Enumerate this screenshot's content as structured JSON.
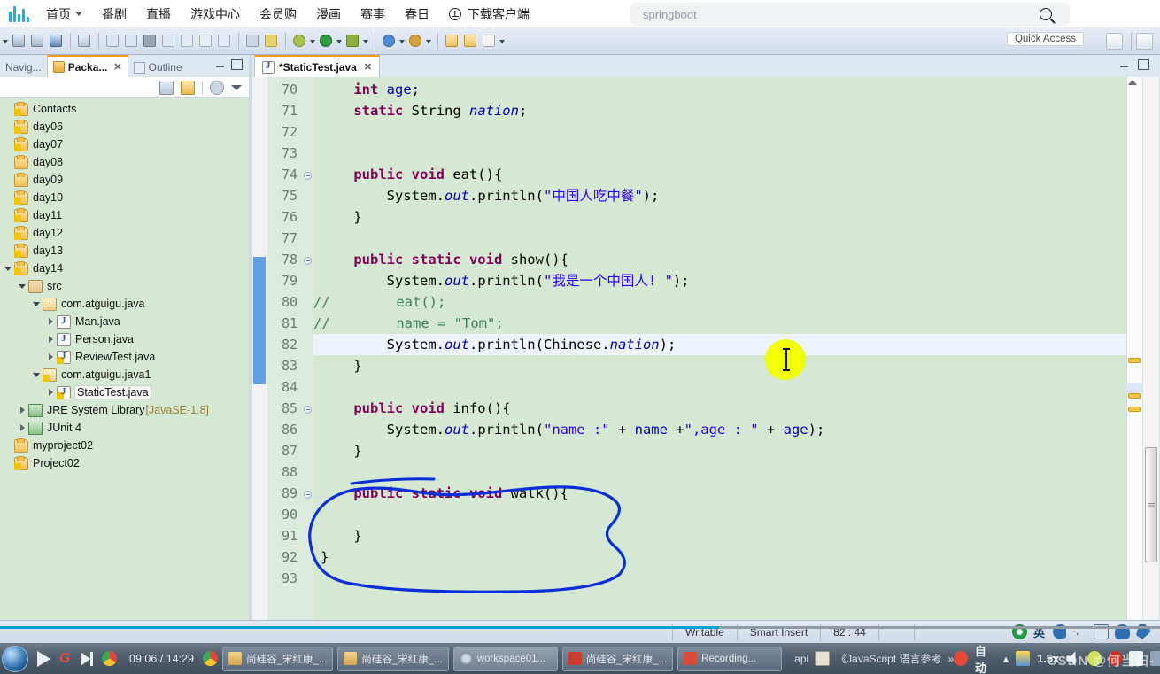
{
  "bilibili": {
    "logo_name": "bilibili-logo",
    "nav": [
      {
        "label": "首页",
        "has_caret": true
      },
      {
        "label": "番剧",
        "has_caret": false
      },
      {
        "label": "直播",
        "has_caret": false
      },
      {
        "label": "游戏中心",
        "has_caret": false
      },
      {
        "label": "会员购",
        "has_caret": false
      },
      {
        "label": "漫画",
        "has_caret": false
      },
      {
        "label": "赛事",
        "has_caret": false
      },
      {
        "label": "春日",
        "has_caret": false
      }
    ],
    "download_label": "下载客户端",
    "search": {
      "value": "springboot",
      "placeholder": "搜索"
    }
  },
  "eclipse": {
    "quick_access": "Quick Access",
    "explorer": {
      "tabs": [
        {
          "label": "Navig...",
          "active": false
        },
        {
          "label": "Packa...",
          "active": true
        },
        {
          "label": "Outline",
          "active": false
        }
      ],
      "tree": [
        {
          "label": "Contacts",
          "depth": 0,
          "icon": "project-warn",
          "twist": "none"
        },
        {
          "label": "day06",
          "depth": 0,
          "icon": "project-warn",
          "twist": "none"
        },
        {
          "label": "day07",
          "depth": 0,
          "icon": "project-warn",
          "twist": "none"
        },
        {
          "label": "day08",
          "depth": 0,
          "icon": "project",
          "twist": "none"
        },
        {
          "label": "day09",
          "depth": 0,
          "icon": "project",
          "twist": "none"
        },
        {
          "label": "day10",
          "depth": 0,
          "icon": "project-warn",
          "twist": "none"
        },
        {
          "label": "day11",
          "depth": 0,
          "icon": "project-warn",
          "twist": "none"
        },
        {
          "label": "day12",
          "depth": 0,
          "icon": "project-warn",
          "twist": "none"
        },
        {
          "label": "day13",
          "depth": 0,
          "icon": "project-warn",
          "twist": "none"
        },
        {
          "label": "day14",
          "depth": 0,
          "icon": "project-warn",
          "twist": "open"
        },
        {
          "label": "src",
          "depth": 1,
          "icon": "src",
          "twist": "open"
        },
        {
          "label": "com.atguigu.java",
          "depth": 2,
          "icon": "package",
          "twist": "open"
        },
        {
          "label": "Man.java",
          "depth": 3,
          "icon": "java",
          "twist": "closed"
        },
        {
          "label": "Person.java",
          "depth": 3,
          "icon": "java",
          "twist": "closed"
        },
        {
          "label": "ReviewTest.java",
          "depth": 3,
          "icon": "java-warn",
          "twist": "closed"
        },
        {
          "label": "com.atguigu.java1",
          "depth": 2,
          "icon": "package-warn",
          "twist": "open"
        },
        {
          "label": "StaticTest.java",
          "depth": 3,
          "icon": "java-warn",
          "twist": "closed",
          "selected": true
        },
        {
          "label": "JRE System Library",
          "suffix": "[JavaSE-1.8]",
          "depth": 1,
          "icon": "library",
          "twist": "closed"
        },
        {
          "label": "JUnit 4",
          "depth": 1,
          "icon": "library",
          "twist": "closed"
        },
        {
          "label": "myproject02",
          "depth": 0,
          "icon": "project",
          "twist": "none"
        },
        {
          "label": "Project02",
          "depth": 0,
          "icon": "project-warn",
          "twist": "none"
        }
      ]
    },
    "editor": {
      "tab_label": "*StaticTest.java",
      "first_line": 70,
      "lines": [
        {
          "n": 70,
          "fold": false,
          "tokens": [
            {
              "t": "    ",
              "c": ""
            },
            {
              "t": "int",
              "c": "kw"
            },
            {
              "t": " ",
              "c": ""
            },
            {
              "t": "age",
              "c": "fld"
            },
            {
              "t": ";",
              "c": ""
            }
          ]
        },
        {
          "n": 71,
          "fold": false,
          "tokens": [
            {
              "t": "    ",
              "c": ""
            },
            {
              "t": "static",
              "c": "kw"
            },
            {
              "t": " String ",
              "c": ""
            },
            {
              "t": "nation",
              "c": "stat"
            },
            {
              "t": ";",
              "c": ""
            }
          ]
        },
        {
          "n": 72,
          "fold": false,
          "tokens": []
        },
        {
          "n": 73,
          "fold": false,
          "tokens": []
        },
        {
          "n": 74,
          "fold": true,
          "tokens": [
            {
              "t": "    ",
              "c": ""
            },
            {
              "t": "public void",
              "c": "kw"
            },
            {
              "t": " eat(){",
              "c": ""
            }
          ]
        },
        {
          "n": 75,
          "fold": false,
          "tokens": [
            {
              "t": "        System.",
              "c": ""
            },
            {
              "t": "out",
              "c": "stat"
            },
            {
              "t": ".println(",
              "c": ""
            },
            {
              "t": "\"中国人吃中餐\"",
              "c": "str"
            },
            {
              "t": ");",
              "c": ""
            }
          ]
        },
        {
          "n": 76,
          "fold": false,
          "tokens": [
            {
              "t": "    }",
              "c": ""
            }
          ]
        },
        {
          "n": 77,
          "fold": false,
          "tokens": []
        },
        {
          "n": 78,
          "fold": true,
          "tokens": [
            {
              "t": "    ",
              "c": ""
            },
            {
              "t": "public static void",
              "c": "kw"
            },
            {
              "t": " show(){",
              "c": ""
            }
          ]
        },
        {
          "n": 79,
          "fold": false,
          "tokens": [
            {
              "t": "        System.",
              "c": ""
            },
            {
              "t": "out",
              "c": "stat"
            },
            {
              "t": ".println(",
              "c": ""
            },
            {
              "t": "\"我是一个中国人! \"",
              "c": "str"
            },
            {
              "t": ");",
              "c": ""
            }
          ]
        },
        {
          "n": 80,
          "fold": false,
          "comment_prefix": "//",
          "tokens": [
            {
              "t": "        eat();",
              "c": "cmt"
            }
          ]
        },
        {
          "n": 81,
          "fold": false,
          "comment_prefix": "//",
          "tokens": [
            {
              "t": "        name = ",
              "c": "cmt"
            },
            {
              "t": "\"Tom\"",
              "c": "cmt"
            },
            {
              "t": ";",
              "c": "cmt"
            }
          ]
        },
        {
          "n": 82,
          "fold": false,
          "highlight": true,
          "tokens": [
            {
              "t": "        System.",
              "c": ""
            },
            {
              "t": "out",
              "c": "stat"
            },
            {
              "t": ".println(Chinese.",
              "c": ""
            },
            {
              "t": "nation",
              "c": "stat"
            },
            {
              "t": ");",
              "c": ""
            }
          ]
        },
        {
          "n": 83,
          "fold": false,
          "tokens": [
            {
              "t": "    }",
              "c": ""
            }
          ]
        },
        {
          "n": 84,
          "fold": false,
          "tokens": []
        },
        {
          "n": 85,
          "fold": true,
          "tokens": [
            {
              "t": "    ",
              "c": ""
            },
            {
              "t": "public void",
              "c": "kw"
            },
            {
              "t": " info(){",
              "c": ""
            }
          ]
        },
        {
          "n": 86,
          "fold": false,
          "tokens": [
            {
              "t": "        System.",
              "c": ""
            },
            {
              "t": "out",
              "c": "stat"
            },
            {
              "t": ".println(",
              "c": ""
            },
            {
              "t": "\"name :\"",
              "c": "str"
            },
            {
              "t": " + ",
              "c": ""
            },
            {
              "t": "name",
              "c": "fld"
            },
            {
              "t": " +",
              "c": ""
            },
            {
              "t": "\",age : \"",
              "c": "str"
            },
            {
              "t": " + ",
              "c": ""
            },
            {
              "t": "age",
              "c": "fld"
            },
            {
              "t": ");",
              "c": ""
            }
          ]
        },
        {
          "n": 87,
          "fold": false,
          "tokens": [
            {
              "t": "    }",
              "c": ""
            }
          ]
        },
        {
          "n": 88,
          "fold": false,
          "changed": true,
          "tokens": []
        },
        {
          "n": 89,
          "fold": true,
          "changed": true,
          "tokens": [
            {
              "t": "    ",
              "c": ""
            },
            {
              "t": "public static void",
              "c": "kw"
            },
            {
              "t": " walk(){",
              "c": ""
            }
          ]
        },
        {
          "n": 90,
          "fold": false,
          "changed": true,
          "tokens": []
        },
        {
          "n": 91,
          "fold": false,
          "changed": true,
          "tokens": [
            {
              "t": "    }",
              "c": ""
            }
          ]
        },
        {
          "n": 92,
          "fold": false,
          "tokens": [
            {
              "t": "}",
              "c": ""
            }
          ]
        },
        {
          "n": 93,
          "fold": false,
          "tokens": []
        }
      ]
    },
    "status": {
      "writable": "Writable",
      "insert_mode": "Smart Insert",
      "caret_position": "82 : 44"
    },
    "ime": {
      "lang": "英"
    }
  },
  "player": {
    "time": "09:06 / 14:29",
    "progress_percent": 62,
    "speed": "1.5x",
    "auto_label": "自动"
  },
  "taskbar": {
    "apps": [
      {
        "label": "尚硅谷_宋红康_...",
        "icon_color": "#d9b46a",
        "active": false
      },
      {
        "label": "尚硅谷_宋红康_...",
        "icon_color": "#d9b46a",
        "active": false
      },
      {
        "label": "workspace01...",
        "icon_color": "#8899aa",
        "active": true
      },
      {
        "label": "尚硅谷_宋红康_...",
        "icon_color": "#cc3c2e",
        "active": false
      },
      {
        "label": "Recording...",
        "icon_color": "#d64b3a",
        "active": false
      }
    ],
    "misc": [
      "api",
      "《JavaScript 语言参考",
      "»"
    ]
  },
  "watermark": "CSDN @何当归-"
}
